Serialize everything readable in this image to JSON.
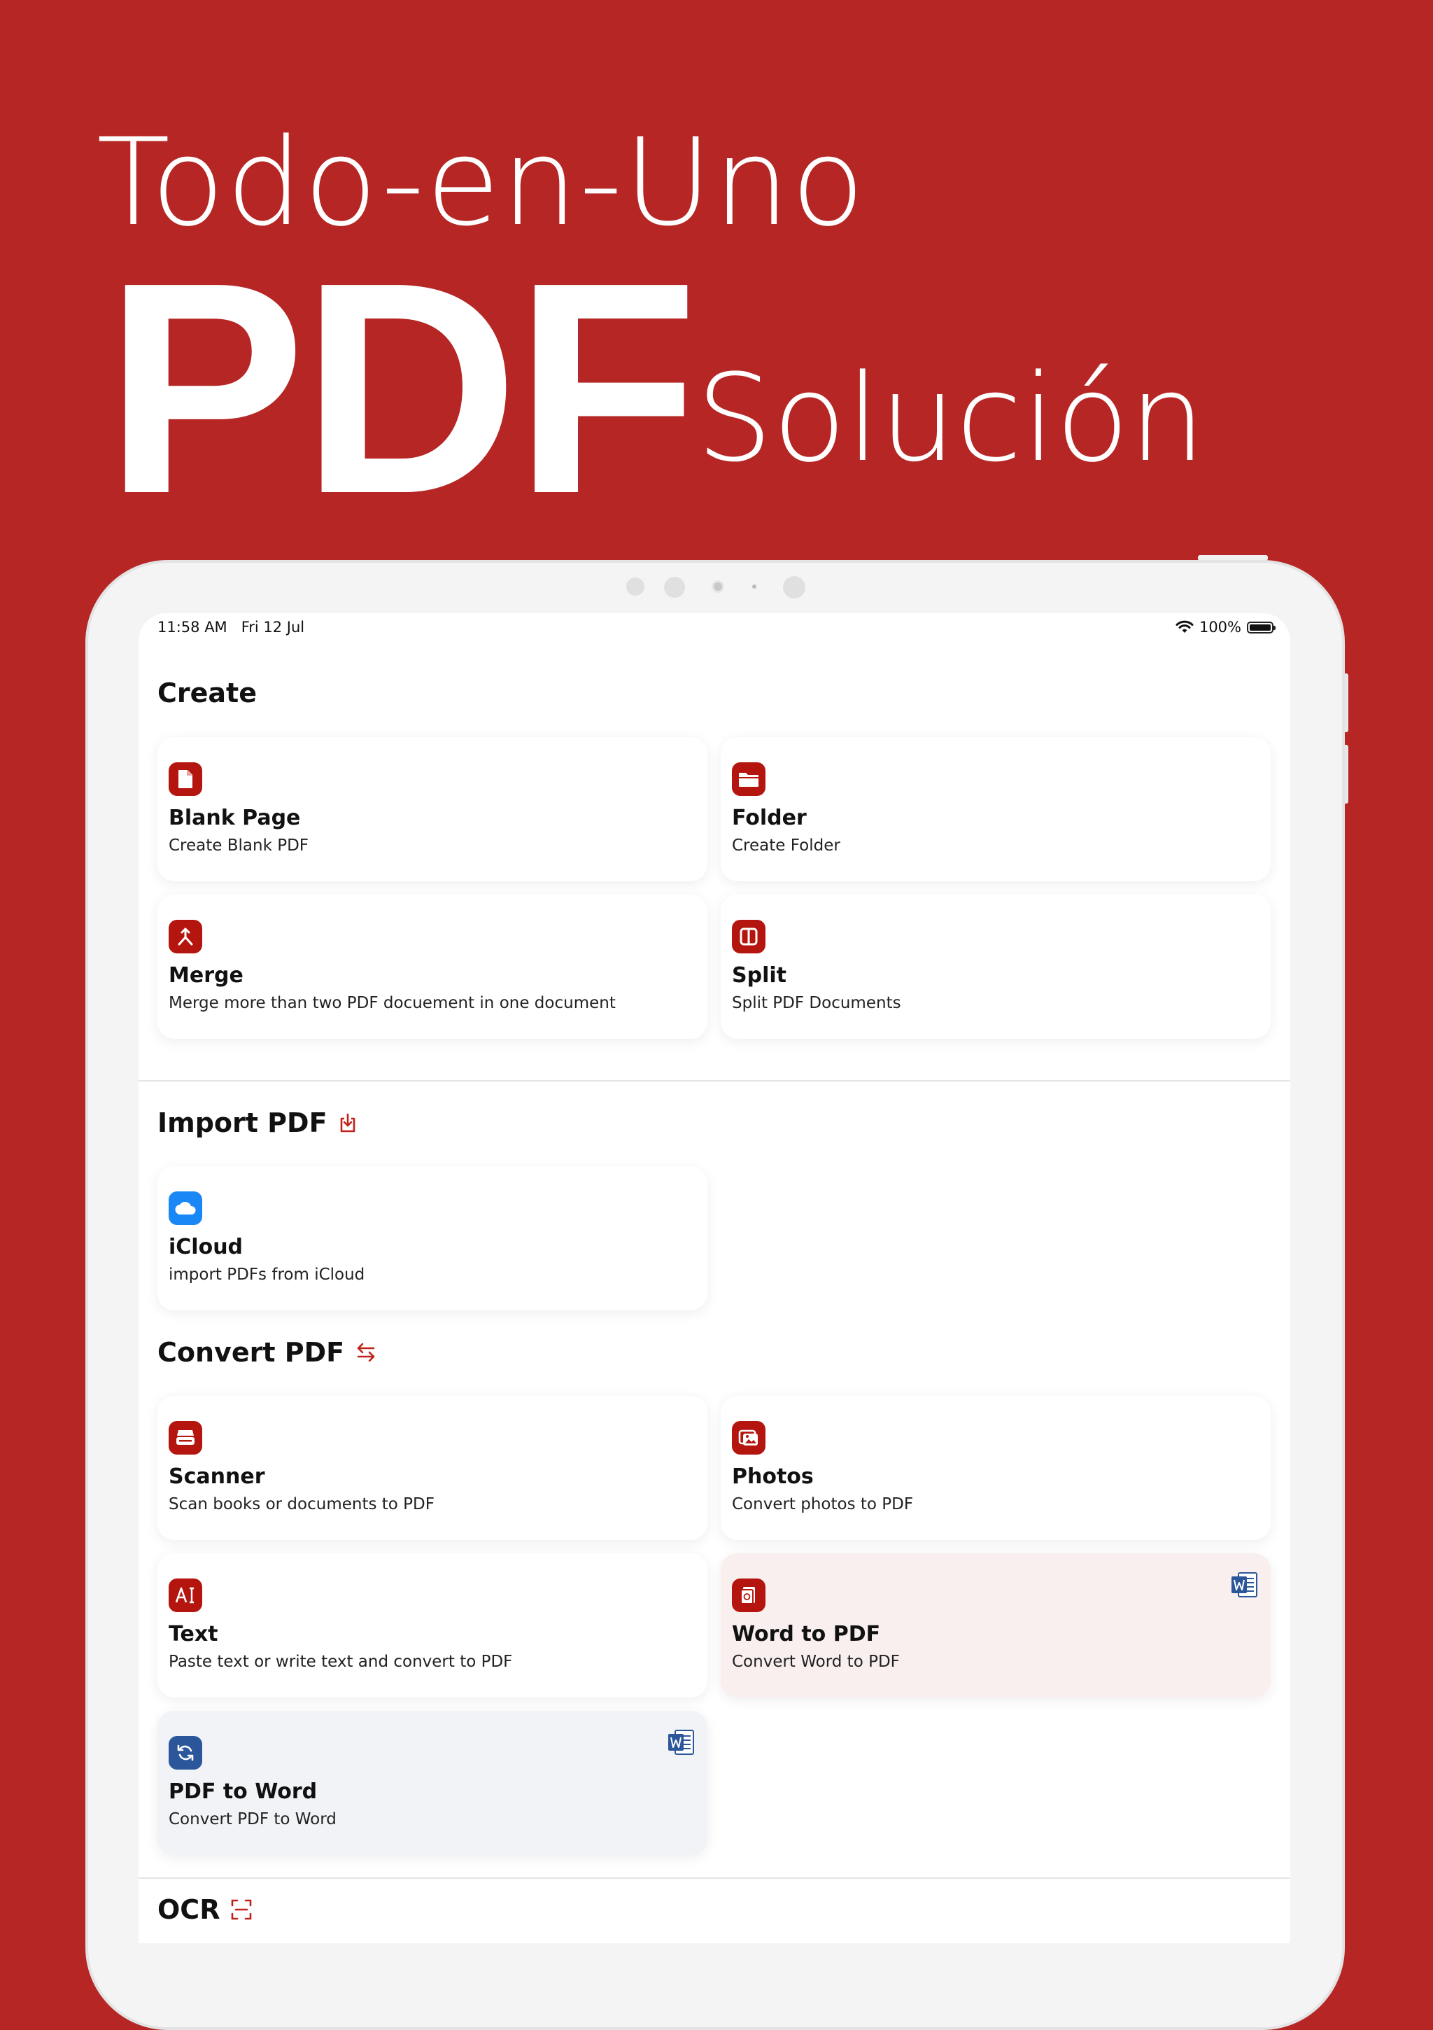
{
  "hero": {
    "line1": "Todo-en-Uno",
    "big": "PDF",
    "suffix": "Solución"
  },
  "colors": {
    "background": "#b52624",
    "accent": "#b4160f",
    "icloud": "#1a87f6",
    "word": "#2b579a"
  },
  "status_bar": {
    "time": "11:58 AM   Fri 12 Jul",
    "battery": "100%",
    "icons": [
      "wifi-icon",
      "battery-icon"
    ]
  },
  "sections": {
    "create": {
      "title": "Create",
      "cards": [
        {
          "title": "Blank Page",
          "subtitle": "Create Blank PDF",
          "icon": "blank-page-icon"
        },
        {
          "title": "Folder",
          "subtitle": "Create Folder",
          "icon": "folder-icon"
        },
        {
          "title": "Merge",
          "subtitle": "Merge more than two PDF docuement in one document",
          "icon": "merge-icon"
        },
        {
          "title": "Split",
          "subtitle": "Split PDF Documents",
          "icon": "split-icon"
        }
      ]
    },
    "import": {
      "title": "Import PDF",
      "title_icon": "import-icon",
      "cards": [
        {
          "title": "iCloud",
          "subtitle": "import PDFs from iCloud",
          "icon": "icloud-icon"
        }
      ]
    },
    "convert": {
      "title": "Convert PDF",
      "title_icon": "convert-arrows-icon",
      "cards": [
        {
          "title": "Scanner",
          "subtitle": "Scan books or documents to PDF",
          "icon": "scanner-icon"
        },
        {
          "title": "Photos",
          "subtitle": "Convert photos to PDF",
          "icon": "photos-icon"
        },
        {
          "title": "Text",
          "subtitle": "Paste text or write text and convert to PDF",
          "icon": "text-icon"
        },
        {
          "title": "Word to PDF",
          "subtitle": "Convert Word to PDF",
          "icon": "word-to-pdf-icon",
          "badge": "word-icon"
        },
        {
          "title": "PDF to Word",
          "subtitle": "Convert PDF to Word",
          "icon": "pdf-to-word-icon",
          "badge": "word-icon"
        }
      ]
    },
    "ocr": {
      "title": "OCR",
      "title_icon": "ocr-scan-icon"
    }
  }
}
